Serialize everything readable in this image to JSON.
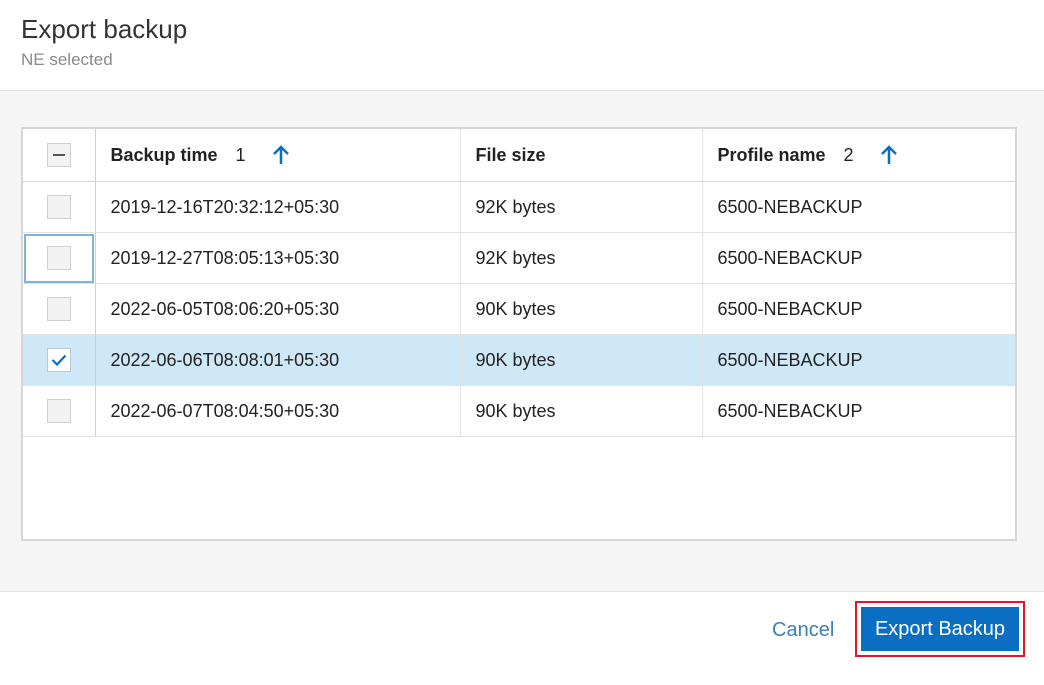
{
  "dialog": {
    "title": "Export backup",
    "subtitle": "NE selected"
  },
  "table": {
    "columns": [
      {
        "label": "Backup time",
        "sort_order": "1"
      },
      {
        "label": "File size"
      },
      {
        "label": "Profile name",
        "sort_order": "2"
      }
    ],
    "rows": [
      {
        "time": "2019-12-16T20:32:12+05:30",
        "size": "92K bytes",
        "profile": "6500-NEBACKUP",
        "checked": false
      },
      {
        "time": "2019-12-27T08:05:13+05:30",
        "size": "92K bytes",
        "profile": "6500-NEBACKUP",
        "checked": false
      },
      {
        "time": "2022-06-05T08:06:20+05:30",
        "size": "90K bytes",
        "profile": "6500-NEBACKUP",
        "checked": false
      },
      {
        "time": "2022-06-06T08:08:01+05:30",
        "size": "90K bytes",
        "profile": "6500-NEBACKUP",
        "checked": true
      },
      {
        "time": "2022-06-07T08:04:50+05:30",
        "size": "90K bytes",
        "profile": "6500-NEBACKUP",
        "checked": false
      }
    ]
  },
  "footer": {
    "cancel_label": "Cancel",
    "export_label": "Export Backup"
  },
  "colors": {
    "accent": "#0a6fc2",
    "selected_row": "#cfe8f7",
    "highlight_outline": "#e0162b",
    "link": "#3c7fb9"
  },
  "icons": {
    "sort": "arrow-up-icon",
    "check": "check-icon",
    "indeterminate": "minus-icon"
  }
}
